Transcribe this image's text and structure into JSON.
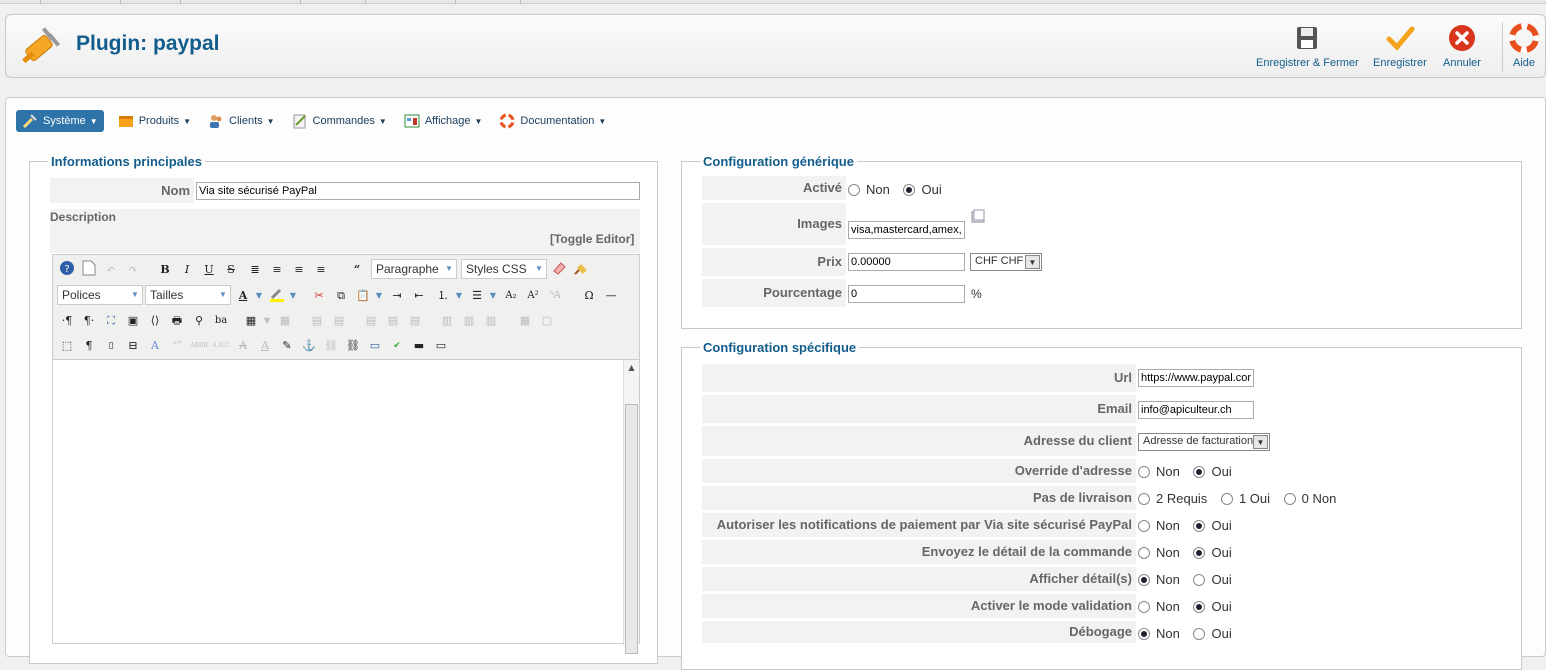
{
  "header": {
    "title": "Plugin: paypal",
    "actions": {
      "save_close": "Enregistrer & Fermer",
      "save": "Enregistrer",
      "cancel": "Annuler",
      "help": "Aide"
    }
  },
  "menu": {
    "system": "Système",
    "products": "Produits",
    "customers": "Clients",
    "orders": "Commandes",
    "display": "Affichage",
    "documentation": "Documentation"
  },
  "main_info": {
    "legend": "Informations principales",
    "name_label": "Nom",
    "name_value": "Via site sécurisé PayPal",
    "description_label": "Description",
    "toggle_editor": "[Toggle Editor]",
    "editor": {
      "format_select": "Paragraphe",
      "styles_select": "Styles CSS",
      "fonts_select": "Polices",
      "sizes_select": "Tailles"
    }
  },
  "generic": {
    "legend": "Configuration générique",
    "active_label": "Activé",
    "active_options": [
      "Non",
      "Oui"
    ],
    "active_selected": "Oui",
    "images_label": "Images",
    "images_value": "visa,mastercard,amex,paypal",
    "price_label": "Prix",
    "price_value": "0.00000",
    "currency_value": "CHF CHF",
    "percent_label": "Pourcentage",
    "percent_value": "0",
    "percent_sign": "%"
  },
  "specific": {
    "legend": "Configuration spécifique",
    "url_label": "Url",
    "url_value": "https://www.paypal.com",
    "email_label": "Email",
    "email_value": "info@apiculteur.ch",
    "address_label": "Adresse du client",
    "address_value": "Adresse de facturation",
    "override_label": "Override d'adresse",
    "no_shipping_label": "Pas de livraison",
    "no_shipping_options": [
      "2 Requis",
      "1 Oui",
      "0 Non"
    ],
    "notify_label": "Autoriser les notifications de paiement par Via site sécurisé PayPal",
    "send_details_label": "Envoyez le détail de la commande",
    "show_details_label": "Afficher détail(s)",
    "validation_label": "Activer le mode validation",
    "debug_label": "Débogage",
    "non": "Non",
    "oui": "Oui"
  }
}
